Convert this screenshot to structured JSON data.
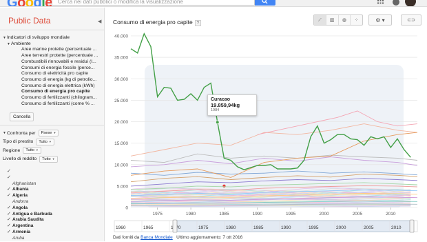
{
  "header": {
    "logo_letters": [
      "G",
      "o",
      "o",
      "g",
      "l",
      "e"
    ],
    "search_placeholder": "Cerca nei dati pubblici o modifica la visualizzazione"
  },
  "sidebar": {
    "title": "Public Data",
    "tree": [
      {
        "label": "Indicatori di sviluppo mondiale",
        "level": 0,
        "expanded": true
      },
      {
        "label": "Ambiente",
        "level": 1,
        "expanded": true
      },
      {
        "label": "Aree marine protette (percentuale ...",
        "level": 2
      },
      {
        "label": "Aree terrestri protette (percentuale ...",
        "level": 2
      },
      {
        "label": "Combustibili rinnovabili e residui (I...",
        "level": 2
      },
      {
        "label": "Consumi di energia fossile (perce...",
        "level": 2
      },
      {
        "label": "Consumo di elettricità pro capite",
        "level": 2
      },
      {
        "label": "Consumo di energia (kg di petrolio...",
        "level": 2
      },
      {
        "label": "Consumo di energia elettrica (kWh)",
        "level": 2
      },
      {
        "label": "Consumo di energia pro capite",
        "level": 2,
        "selected": true
      },
      {
        "label": "Consumo di fertilizzanti (chilogram...",
        "level": 2
      },
      {
        "label": "Consumo di fertilizzanti (come % ...",
        "level": 2
      }
    ],
    "cancel_label": "Cancella",
    "filters": [
      {
        "label": "Confronta per",
        "value": "Paese",
        "expanded": true
      },
      {
        "label": "Tipo di prestito",
        "value": "Tutto"
      },
      {
        "label": "Regione",
        "value": "Tutto"
      },
      {
        "label": "Livello di reddito",
        "value": "Tutto"
      }
    ],
    "countries": [
      {
        "label": "",
        "checked": true,
        "style": "plain"
      },
      {
        "label": "",
        "checked": true,
        "style": "plain"
      },
      {
        "label": "Afghanistan",
        "checked": false,
        "style": "italic"
      },
      {
        "label": "Albania",
        "checked": true,
        "style": "bold"
      },
      {
        "label": "Algeria",
        "checked": true,
        "style": "bold"
      },
      {
        "label": "Andorra",
        "checked": false,
        "style": "italic"
      },
      {
        "label": "Angola",
        "checked": true,
        "style": "bold"
      },
      {
        "label": "Antigua e Barbuda",
        "checked": true,
        "style": "bold"
      },
      {
        "label": "Arabia Saudita",
        "checked": true,
        "style": "bold"
      },
      {
        "label": "Argentina",
        "checked": true,
        "style": "bold"
      },
      {
        "label": "Armenia",
        "checked": true,
        "style": "bold"
      },
      {
        "label": "Aruba",
        "checked": false,
        "style": "italic"
      }
    ]
  },
  "main": {
    "title": "Consumo di energia pro capite",
    "help": "?",
    "view_buttons": [
      {
        "name": "line-chart-icon",
        "glyph": "⟋",
        "active": true
      },
      {
        "name": "bar-chart-icon",
        "glyph": "▥",
        "active": false
      },
      {
        "name": "map-icon",
        "glyph": "◍",
        "active": false
      },
      {
        "name": "bubble-chart-icon",
        "glyph": "⁘",
        "active": false
      }
    ],
    "settings_glyph": "⚙ ▾",
    "link_glyph": "⊂⊃",
    "tooltip": {
      "country": "Curacao",
      "value": "19.859,94kg",
      "year": "1984"
    }
  },
  "chart_data": {
    "type": "line",
    "title": "Consumo di energia pro capite",
    "yticks": [
      "0",
      "5.000",
      "10.000",
      "15.000",
      "20.000",
      "25.000",
      "30.000",
      "35.000",
      "40.000"
    ],
    "ylim": [
      0,
      40000
    ],
    "xlim": [
      1971,
      2014
    ],
    "xticks": [
      "1975",
      "1980",
      "1985",
      "1990",
      "1995",
      "2000",
      "2005",
      "2010"
    ],
    "grid": true,
    "series": [
      {
        "name": "Curacao",
        "color": "#43a047",
        "highlight": true,
        "x": [
          1971,
          1972,
          1973,
          1974,
          1975,
          1976,
          1977,
          1978,
          1979,
          1980,
          1981,
          1982,
          1983,
          1984,
          1985,
          1986,
          1987,
          1988,
          1989,
          1990,
          1991,
          1992,
          1993,
          1994,
          1995,
          1996,
          1997,
          1998,
          1999,
          2000,
          2001,
          2002,
          2003,
          2004,
          2005,
          2006,
          2007,
          2008,
          2009,
          2010,
          2011,
          2012,
          2013
        ],
        "y": [
          37000,
          36000,
          40500,
          37500,
          25800,
          28000,
          27800,
          25000,
          25200,
          26500,
          25000,
          28000,
          29000,
          19860,
          11500,
          11000,
          9500,
          8800,
          9300,
          9800,
          9800,
          10000,
          9000,
          9000,
          9000,
          9200,
          11000,
          16500,
          19000,
          15000,
          15800,
          17000,
          17000,
          16000,
          15800,
          14500,
          16500,
          16000,
          16500,
          14000,
          16000,
          13500,
          11700
        ]
      },
      {
        "name": "",
        "color": "#f4a6b4",
        "x": [
          1990,
          1993,
          1996,
          1999,
          2002,
          2005,
          2008,
          2011,
          2014
        ],
        "y": [
          17000,
          18000,
          19000,
          20000,
          21000,
          22500,
          20000,
          19000,
          19500
        ]
      },
      {
        "name": "",
        "color": "#e69a5c",
        "x": [
          1971,
          1976,
          1981,
          1986,
          1991,
          1996,
          2001,
          2006,
          2011,
          2014
        ],
        "y": [
          7500,
          8500,
          9000,
          7000,
          10500,
          11500,
          12000,
          15500,
          17000,
          17500
        ]
      },
      {
        "name": "",
        "color": "#f2b6a0",
        "x": [
          1971,
          1976,
          1981,
          1986,
          1991,
          1996,
          2001,
          2006,
          2011,
          2014
        ],
        "y": [
          12000,
          13500,
          15000,
          14500,
          17500,
          17000,
          18000,
          19500,
          18000,
          17500
        ]
      },
      {
        "name": "",
        "color": "#c9a0dc",
        "x": [
          1971,
          1976,
          1981,
          1986,
          1991,
          1996,
          2001,
          2006,
          2011,
          2014
        ],
        "y": [
          9500,
          10000,
          11000,
          10200,
          11500,
          10800,
          11800,
          11000,
          10500,
          9800
        ]
      },
      {
        "name": "",
        "color": "#7fa6d6",
        "x": [
          1971,
          1976,
          1981,
          1986,
          1991,
          1996,
          2001,
          2006,
          2011,
          2014
        ],
        "y": [
          8000,
          7500,
          8200,
          7800,
          8000,
          8500,
          8000,
          8300,
          7900,
          7600
        ]
      },
      {
        "name": "",
        "color": "#d4a06a",
        "x": [
          1971,
          1976,
          1981,
          1986,
          1991,
          1996,
          2001,
          2006,
          2011,
          2014
        ],
        "y": [
          6000,
          6800,
          7200,
          6500,
          7000,
          7400,
          7100,
          7800,
          7500,
          7200
        ]
      },
      {
        "name": "",
        "color": "#bbb",
        "x": [
          1971,
          1976,
          1981,
          1986,
          1991,
          1996,
          2001,
          2006,
          2011,
          2014
        ],
        "y": [
          11000,
          10500,
          12500,
          11500,
          12000,
          11500,
          12200,
          11800,
          11500,
          11000
        ]
      },
      {
        "name": "",
        "color": "#8c7bd0",
        "x": [
          1971,
          1976,
          1981,
          1986,
          1991,
          1996,
          2001,
          2006,
          2011,
          2014
        ],
        "y": [
          5000,
          5500,
          6000,
          5800,
          6200,
          6500,
          6300,
          6800,
          6500,
          6300
        ]
      },
      {
        "name": "",
        "color": "#a5d6a7",
        "x": [
          1971,
          1976,
          1981,
          1986,
          1991,
          1996,
          2001,
          2006,
          2011,
          2014
        ],
        "y": [
          4200,
          4500,
          5000,
          4800,
          5200,
          5400,
          5600,
          5800,
          5500,
          5300
        ]
      },
      {
        "name": "",
        "color": "#ef9a9a",
        "x": [
          1971,
          1976,
          1981,
          1986,
          1991,
          1996,
          2001,
          2006,
          2011,
          2014
        ],
        "y": [
          3500,
          3800,
          4200,
          4000,
          4500,
          4700,
          4900,
          5100,
          5000,
          4800
        ]
      },
      {
        "name": "",
        "color": "#90caf9",
        "x": [
          1971,
          1976,
          1981,
          1986,
          1991,
          1996,
          2001,
          2006,
          2011,
          2014
        ],
        "y": [
          2800,
          3000,
          3300,
          3100,
          3500,
          3700,
          3900,
          4100,
          4000,
          3900
        ]
      },
      {
        "name": "",
        "color": "#ffcc80",
        "x": [
          1971,
          1976,
          1981,
          1986,
          1991,
          1996,
          2001,
          2006,
          2011,
          2014
        ],
        "y": [
          2000,
          2300,
          2500,
          2400,
          2700,
          2900,
          3100,
          3300,
          3200,
          3100
        ]
      },
      {
        "name": "",
        "color": "#ce93d8",
        "x": [
          1971,
          1976,
          1981,
          1986,
          1991,
          1996,
          2001,
          2006,
          2011,
          2014
        ],
        "y": [
          1400,
          1600,
          1800,
          1700,
          1900,
          2100,
          2300,
          2500,
          2400,
          2300
        ]
      },
      {
        "name": "",
        "color": "#80cbc4",
        "x": [
          1971,
          1976,
          1981,
          1986,
          1991,
          1996,
          2001,
          2006,
          2011,
          2014
        ],
        "y": [
          900,
          1000,
          1100,
          1050,
          1200,
          1300,
          1400,
          1500,
          1450,
          1400
        ]
      },
      {
        "name": "",
        "color": "#b0bec5",
        "x": [
          1971,
          1976,
          1981,
          1986,
          1991,
          1996,
          2001,
          2006,
          2011,
          2014
        ],
        "y": [
          500,
          550,
          600,
          580,
          650,
          700,
          750,
          800,
          780,
          760
        ]
      },
      {
        "name": "",
        "color": "#e53935",
        "x": [
          1985
        ],
        "y": [
          5000
        ],
        "marker": true
      }
    ],
    "timeline": {
      "labels": [
        "1960",
        "1965",
        "1970",
        "1975",
        "1980",
        "1985",
        "1990",
        "1995",
        "2000",
        "2005",
        "2010"
      ],
      "range": [
        1960,
        2015
      ],
      "selected": [
        1971,
        2014
      ]
    }
  },
  "footer": {
    "source_prefix": "Dati forniti da",
    "source_link": "Banca Mondiale",
    "updated": "Ultimo aggiornamento: 7 ott 2016"
  }
}
